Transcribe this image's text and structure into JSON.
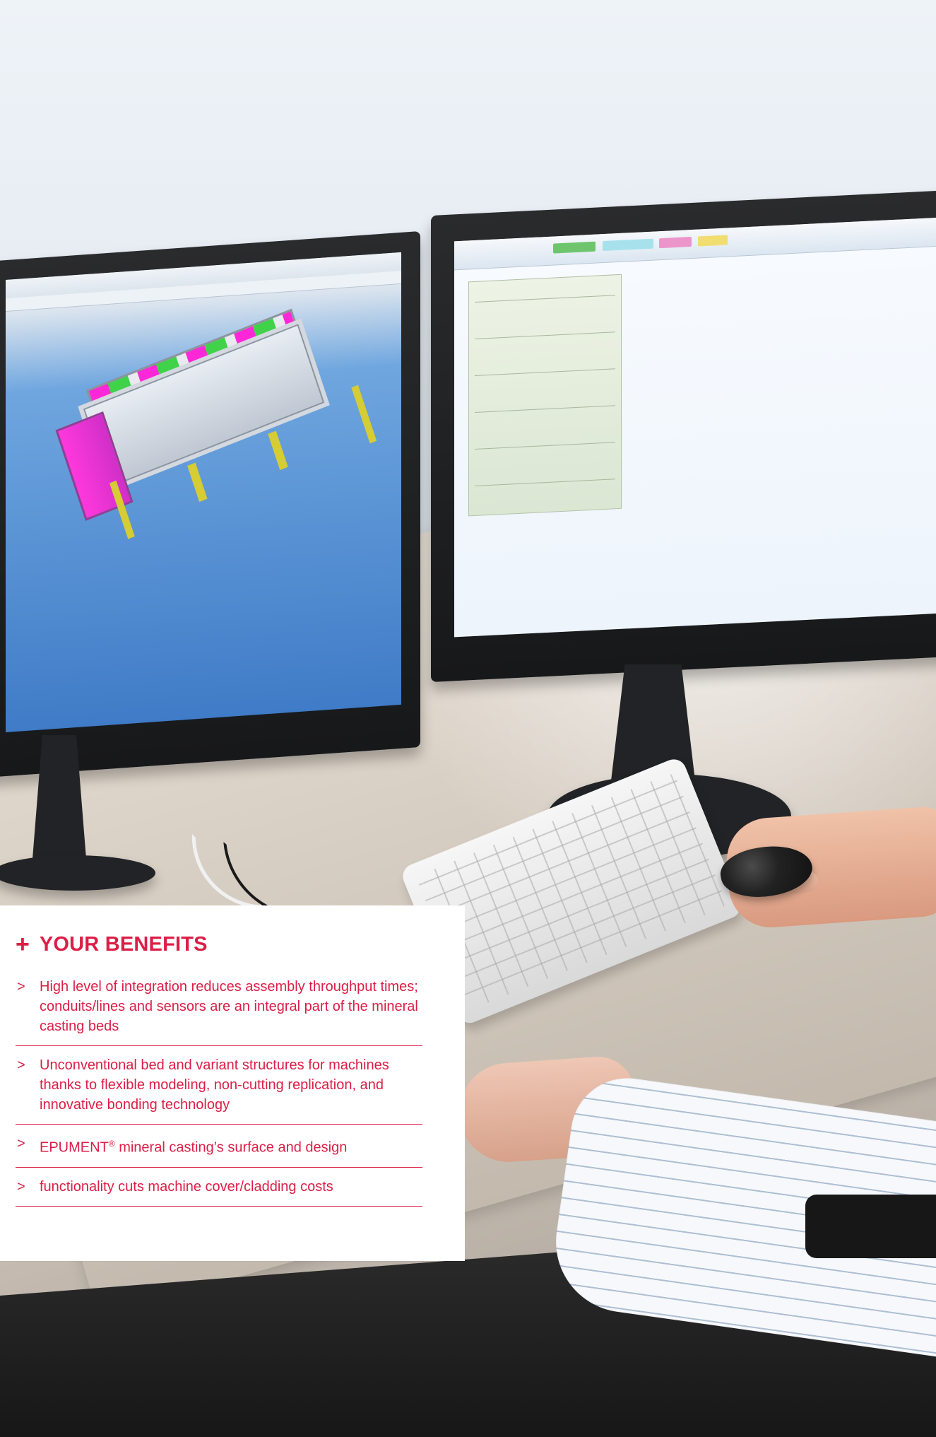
{
  "document": {
    "section_title": "YOUR BENEFITS",
    "icon": "plus-icon",
    "accent_color": "#dc1e46",
    "benefits": [
      {
        "bullet": ">",
        "text": "High level of integration reduces assembly throughput times; conduits/lines and sensors are an integral part of the mineral casting beds"
      },
      {
        "bullet": ">",
        "text": "Unconventional bed and variant structures for machines thanks to flexible modeling, non-cutting replication, and innovative bonding technology"
      },
      {
        "bullet": ">",
        "text_before_mark": "EPUMENT",
        "mark": "®",
        "text_after_mark": " mineral casting’s surface and design"
      },
      {
        "bullet": ">",
        "text": "functionality cuts machine cover/cladding costs"
      }
    ]
  }
}
